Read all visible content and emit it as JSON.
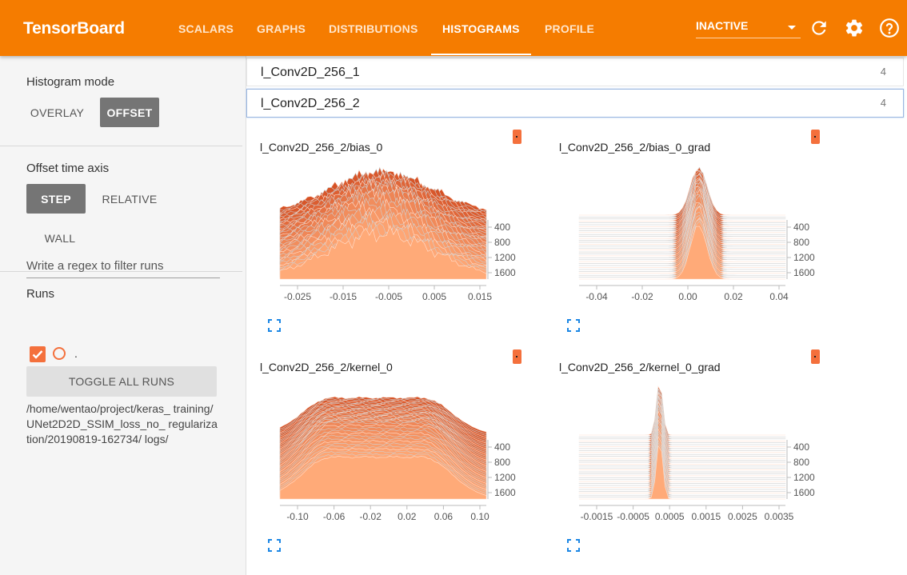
{
  "app": {
    "title": "TensorBoard"
  },
  "nav": {
    "tabs": [
      {
        "label": "SCALARS"
      },
      {
        "label": "GRAPHS"
      },
      {
        "label": "DISTRIBUTIONS"
      },
      {
        "label": "HISTOGRAMS"
      },
      {
        "label": "PROFILE"
      }
    ],
    "active_tab": "HISTOGRAMS",
    "run_select": "INACTIVE",
    "icons": [
      "refresh-icon",
      "settings-icon",
      "help-icon"
    ]
  },
  "sidebar": {
    "histogram_mode": {
      "title": "Histogram mode",
      "overlay": "OVERLAY",
      "offset": "OFFSET",
      "selected": "OFFSET"
    },
    "offset_time_axis": {
      "title": "Offset time axis",
      "step": "STEP",
      "relative": "RELATIVE",
      "wall": "WALL",
      "selected": "STEP"
    },
    "runs": {
      "title": "Runs",
      "filter_placeholder": "Write a regex to filter runs",
      "run_name": ".",
      "toggle_label": "TOGGLE ALL RUNS",
      "logdir": "/home/wentao/project/keras_ training/UNet2D2D_SSIM_loss_no_ regularization/20190819-162734/ logs/"
    }
  },
  "groups": [
    {
      "name": "l_Conv2D_256_1",
      "count": "4"
    },
    {
      "name": "l_Conv2D_256_2",
      "count": "4"
    }
  ],
  "colors": {
    "accent": "#f57c00",
    "run": "#f4703c"
  },
  "charts": [
    {
      "title": "l_Conv2D_256_2/bias_0",
      "x_ticks": [
        "-0.025",
        "-0.015",
        "-0.005",
        "0.005",
        "0.015"
      ],
      "y_ticks": [
        "400",
        "800",
        "1200",
        "1600"
      ]
    },
    {
      "title": "l_Conv2D_256_2/bias_0_grad",
      "x_ticks": [
        "-0.04",
        "-0.02",
        "0.00",
        "0.02",
        "0.04"
      ],
      "y_ticks": [
        "400",
        "800",
        "1200",
        "1600"
      ]
    },
    {
      "title": "l_Conv2D_256_2/kernel_0",
      "x_ticks": [
        "-0.10",
        "-0.06",
        "-0.02",
        "0.02",
        "0.06",
        "0.10"
      ],
      "y_ticks": [
        "400",
        "800",
        "1200",
        "1600"
      ]
    },
    {
      "title": "l_Conv2D_256_2/kernel_0_grad",
      "x_ticks": [
        "-0.0015",
        "-0.0005",
        "0.0005",
        "0.0015",
        "0.0025",
        "0.0035"
      ],
      "y_ticks": [
        "400",
        "800",
        "1200",
        "1600"
      ]
    }
  ]
}
